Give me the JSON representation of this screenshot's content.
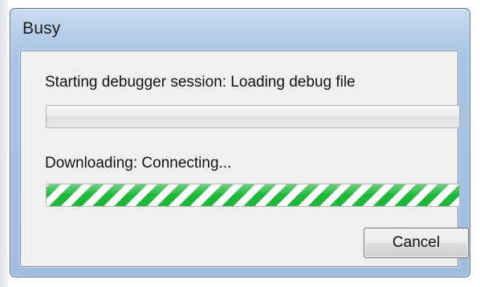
{
  "window": {
    "title": "Busy"
  },
  "status": {
    "session_label": "Starting debugger session: Loading debug file",
    "session_progress": 0,
    "download_label": "Downloading: Connecting...",
    "download_progress": 1.0,
    "download_progress_style": "marquee-striped"
  },
  "buttons": {
    "cancel_label": "Cancel"
  },
  "colors": {
    "frame_blue": "#b8d0ea",
    "client_bg": "#f0f0f0",
    "progress_green": "#1db83a"
  }
}
